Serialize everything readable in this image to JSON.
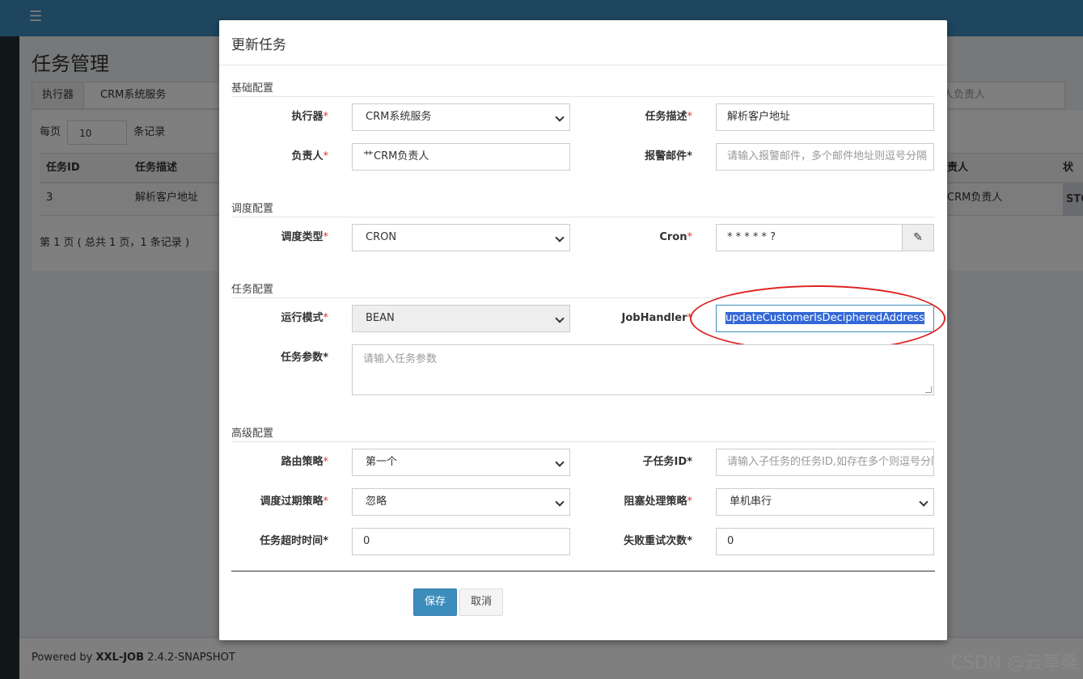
{
  "page": {
    "title": "任务管理",
    "filter": {
      "executor_label": "执行器",
      "executor_value": "CRM系统服务",
      "owner_placeholder": "人负责人"
    },
    "per_page_label": "每页",
    "per_page_value": "10",
    "per_page_suffix": "条记录",
    "columns": [
      "任务ID",
      "任务描述",
      "责人",
      "状态"
    ],
    "rows": [
      {
        "id": "3",
        "desc": "解析客户地址",
        "owner": "CRM负责人",
        "status": "STO"
      }
    ],
    "pager_text": "第 1 页 ( 总共 1 页，1 条记录 )"
  },
  "footer": {
    "prefix": "Powered by ",
    "brand": "XXL-JOB",
    "version": " 2.4.2-SNAPSHOT"
  },
  "watermark": "CSDN @云草桑",
  "modal": {
    "title": "更新任务",
    "sections": {
      "basic": "基础配置",
      "schedule": "调度配置",
      "task": "任务配置",
      "advanced": "高级配置"
    },
    "fields": {
      "executor": {
        "label": "执行器",
        "value": "CRM系统服务"
      },
      "job_desc": {
        "label": "任务描述",
        "value": "解析客户地址"
      },
      "owner": {
        "label": "负责人",
        "value": "艹CRM负责人"
      },
      "alarm_email": {
        "label": "报警邮件",
        "placeholder": "请输入报警邮件，多个邮件地址则逗号分隔"
      },
      "schedule_type": {
        "label": "调度类型",
        "value": "CRON"
      },
      "cron": {
        "label": "Cron",
        "value": "* * * * * ?"
      },
      "glue_type": {
        "label": "运行模式",
        "value": "BEAN"
      },
      "job_handler": {
        "label": "JobHandler",
        "value": "updateCustomerIsDecipheredAddress"
      },
      "job_param": {
        "label": "任务参数",
        "placeholder": "请输入任务参数"
      },
      "route_strategy": {
        "label": "路由策略",
        "value": "第一个"
      },
      "child_job_id": {
        "label": "子任务ID",
        "placeholder": "请输入子任务的任务ID,如存在多个则逗号分隔"
      },
      "misfire_strategy": {
        "label": "调度过期策略",
        "value": "忽略"
      },
      "block_strategy": {
        "label": "阻塞处理策略",
        "value": "单机串行"
      },
      "timeout": {
        "label": "任务超时时间",
        "value": "0"
      },
      "fail_retry": {
        "label": "失败重试次数",
        "value": "0"
      }
    },
    "buttons": {
      "save": "保存",
      "cancel": "取消"
    }
  },
  "colors": {
    "topbar": "#3c8dbc",
    "required": "#d33",
    "highlight_circle": "#d22"
  },
  "icons": {
    "menu": "menu-icon",
    "cron_edit": "edit-icon"
  }
}
